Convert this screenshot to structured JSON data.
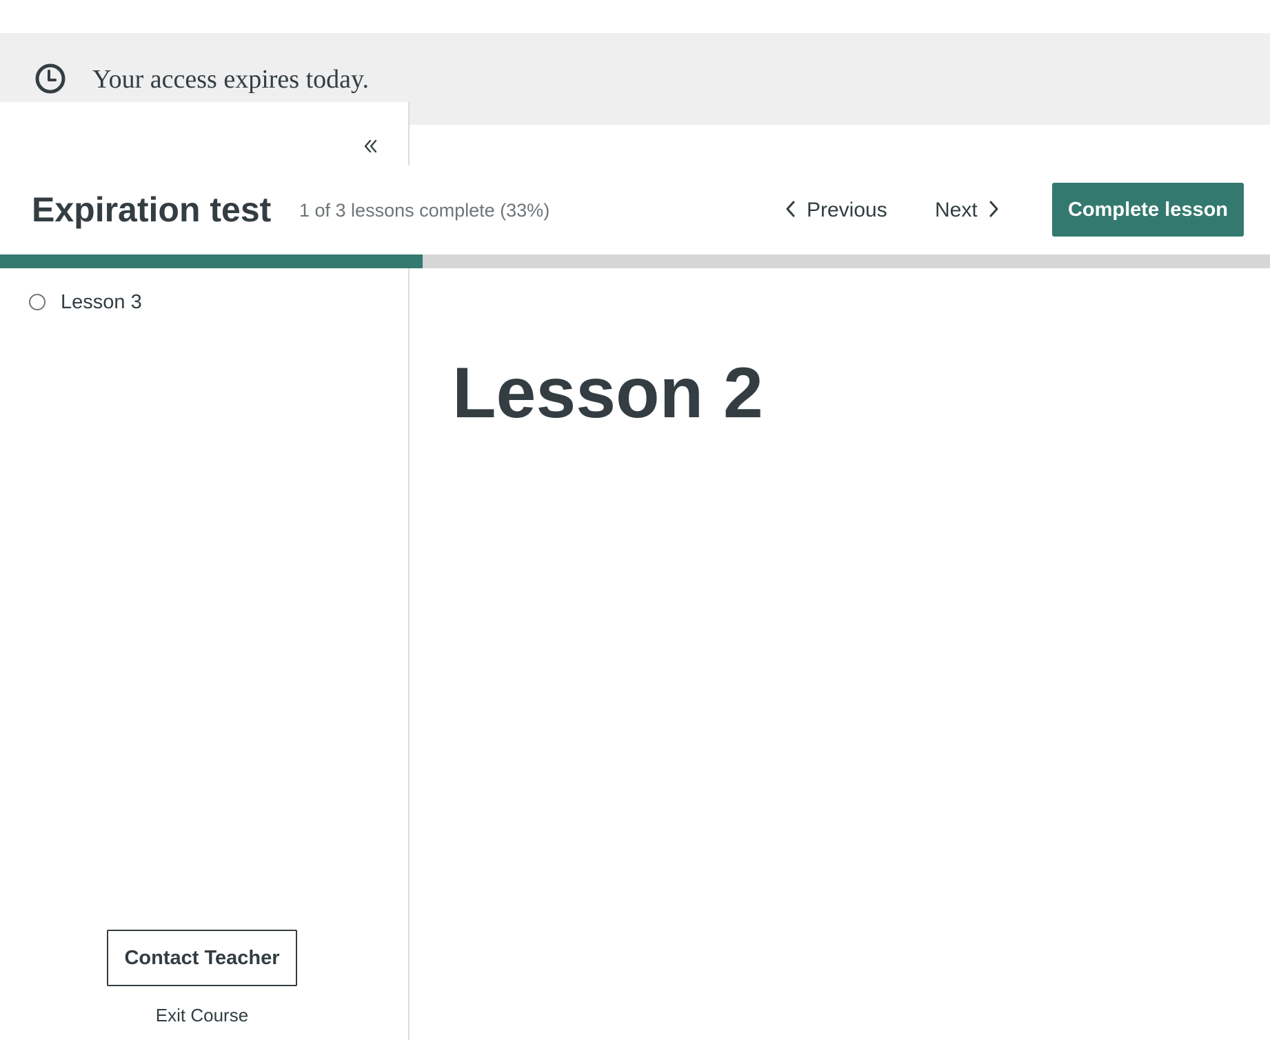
{
  "notice": {
    "icon": "clock-icon",
    "text": "Your access expires today."
  },
  "sidebar": {
    "collapse_icon": "double-chevron-left-icon",
    "lessons": [
      {
        "label": "Lesson 3",
        "status": "incomplete"
      }
    ],
    "contact_label": "Contact Teacher",
    "exit_label": "Exit Course"
  },
  "header": {
    "course_title": "Expiration test",
    "progress_text": "1 of 3 lessons complete (33%)",
    "progress_fraction": 0.333,
    "previous_label": "Previous",
    "next_label": "Next",
    "complete_label": "Complete lesson"
  },
  "main": {
    "lesson_title": "Lesson 2"
  },
  "colors": {
    "accent": "#33796f",
    "text": "#333d42",
    "muted_text": "#6e7478",
    "notice_background": "#efefef",
    "progress_track": "#d6d6d6"
  }
}
